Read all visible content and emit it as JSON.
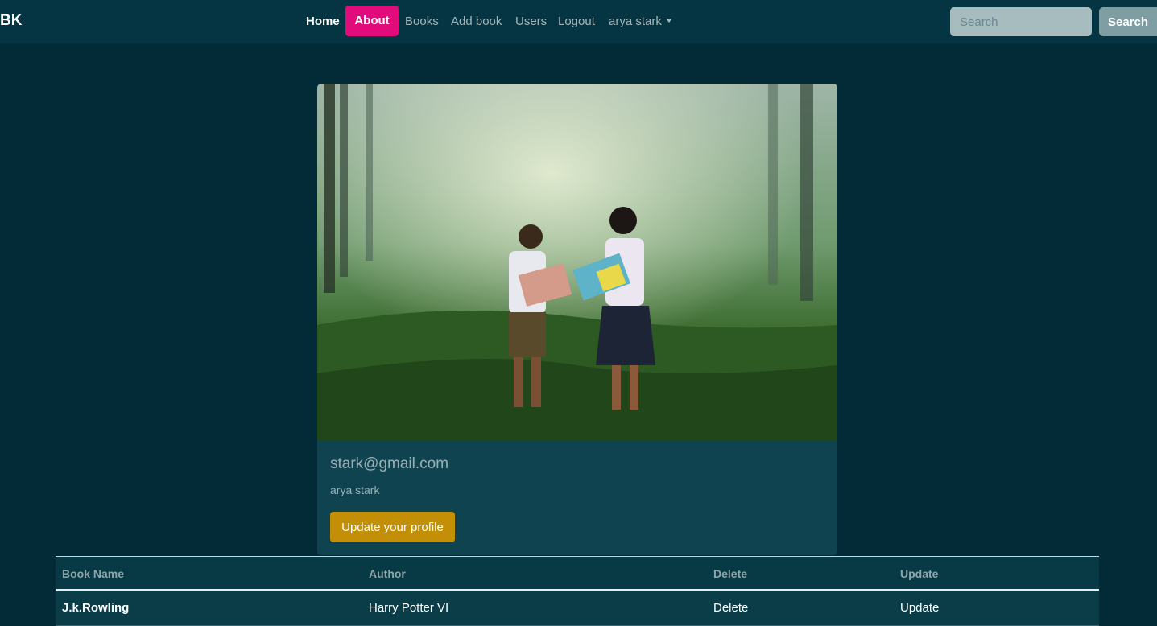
{
  "nav": {
    "brand": "BK",
    "home": "Home",
    "about": "About",
    "books": "Books",
    "add_book": "Add book",
    "users": "Users",
    "logout": "Logout",
    "user_menu": "arya stark",
    "search_placeholder": "Search",
    "search_button": "Search"
  },
  "profile": {
    "email": "stark@gmail.com",
    "name": "arya stark",
    "update_button": "Update your profile"
  },
  "table": {
    "headers": [
      "Book Name",
      "Author",
      "Delete",
      "Update"
    ],
    "rows": [
      [
        "J.k.Rowling",
        "Harry Potter VI",
        "Delete",
        "Update"
      ]
    ]
  },
  "colors": {
    "background": "#022b37",
    "navbar": "#053543",
    "about_active": "#e20b7c",
    "update_button": "#c38f06"
  }
}
